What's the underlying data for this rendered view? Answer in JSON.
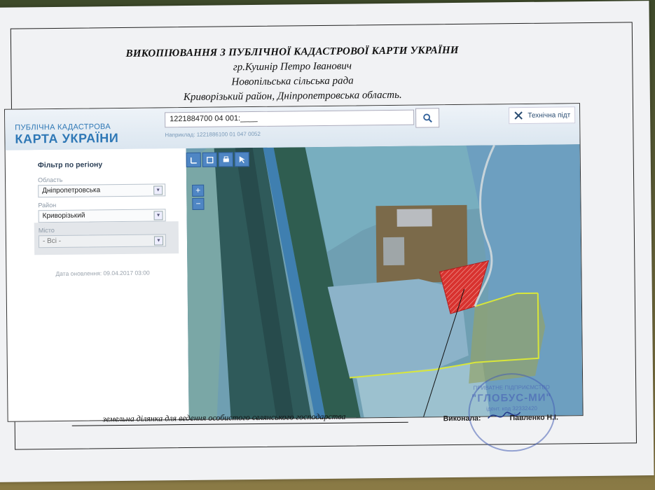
{
  "document": {
    "title": "ВИКОПІЮВАННЯ З ПУБЛІЧНОЇ КАДАСТРОВОЇ КАРТИ УКРАЇНИ",
    "owner": "гр.Кушнір Петро Іванович",
    "council": "Новопільська сільська рада",
    "district": "Криворізький район, Дніпропетровська область.",
    "caption": "земельна ділянка для ведення особистого селянського господарства",
    "executed_label": "Виконала:",
    "executor": "Павленко Н.І."
  },
  "portal": {
    "brand_line1": "ПУБЛІЧНА КАДАСТРОВА",
    "brand_line2": "КАРТА УКРАЇНИ",
    "search_value": "1221884700 04 001:____",
    "search_hint": "Наприклад: 1221886100 01 047 0052",
    "support_label": "Технічна підт",
    "filter_title": "Фільтр по регіону",
    "oblast_label": "Область",
    "oblast_value": "Дніпропетровська",
    "rayon_label": "Район",
    "rayon_value": "Криворізький",
    "city_label": "Місто",
    "city_value": "- Всі -",
    "updated": "Дата оновлення: 09.04.2017 03:00"
  },
  "stamp": {
    "top": "ПРИВАТНЕ ПІДПРИЄМСТВО",
    "name": "\"ГЛОБУС-МИ\"",
    "code": "ідент. код 32332420",
    "num": "№1"
  },
  "colors": {
    "brand": "#2f78b6",
    "parcel": "#e0302c",
    "boundary": "#d8e63a",
    "stamp": "#4660b4"
  }
}
